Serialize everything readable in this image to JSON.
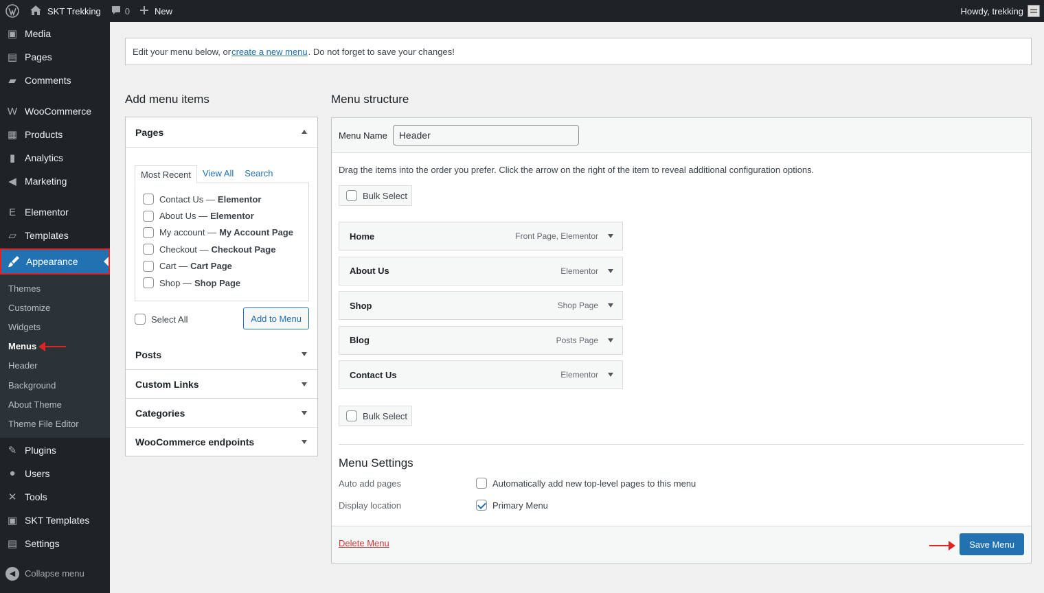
{
  "adminbar": {
    "site_name": "SKT Trekking",
    "comments_count": "0",
    "new_label": "New",
    "howdy": "Howdy, trekking"
  },
  "sidebar": {
    "items_top": [
      {
        "label": "Media",
        "icon": "media-icon"
      },
      {
        "label": "Pages",
        "icon": "pages-icon"
      },
      {
        "label": "Comments",
        "icon": "comments-icon"
      }
    ],
    "items_woo": [
      {
        "label": "WooCommerce",
        "icon": "woocommerce-icon"
      },
      {
        "label": "Products",
        "icon": "products-icon"
      },
      {
        "label": "Analytics",
        "icon": "analytics-icon"
      },
      {
        "label": "Marketing",
        "icon": "marketing-icon"
      }
    ],
    "items_elementor": [
      {
        "label": "Elementor",
        "icon": "elementor-icon"
      },
      {
        "label": "Templates",
        "icon": "templates-icon"
      }
    ],
    "appearance_label": "Appearance",
    "submenu": [
      "Themes",
      "Customize",
      "Widgets",
      "Menus",
      "Header",
      "Background",
      "About Theme",
      "Theme File Editor"
    ],
    "items_bottom": [
      {
        "label": "Plugins",
        "icon": "plugins-icon"
      },
      {
        "label": "Users",
        "icon": "users-icon"
      },
      {
        "label": "Tools",
        "icon": "tools-icon"
      },
      {
        "label": "SKT Templates",
        "icon": "skt-templates-icon"
      },
      {
        "label": "Settings",
        "icon": "settings-icon"
      }
    ],
    "collapse_label": "Collapse menu"
  },
  "notice": {
    "before": "Edit your menu below, or ",
    "link": "create a new menu",
    "after": ". Do not forget to save your changes!"
  },
  "add_items": {
    "title": "Add menu items",
    "pages_label": "Pages",
    "tabs": [
      "Most Recent",
      "View All",
      "Search"
    ],
    "page_options": [
      {
        "name": "Contact Us —",
        "template": "Elementor"
      },
      {
        "name": "About Us —",
        "template": "Elementor"
      },
      {
        "name": "My account —",
        "template": "My Account Page"
      },
      {
        "name": "Checkout —",
        "template": "Checkout Page"
      },
      {
        "name": "Cart —",
        "template": "Cart Page"
      },
      {
        "name": "Shop —",
        "template": "Shop Page"
      }
    ],
    "select_all": "Select All",
    "add_to_menu": "Add to Menu",
    "other_sections": [
      "Posts",
      "Custom Links",
      "Categories",
      "WooCommerce endpoints"
    ]
  },
  "menu_structure": {
    "title": "Menu structure",
    "menu_name_label": "Menu Name",
    "menu_name_value": "Header",
    "instruction": "Drag the items into the order you prefer. Click the arrow on the right of the item to reveal additional configuration options.",
    "bulk_select": "Bulk Select",
    "items": [
      {
        "title": "Home",
        "type": "Front Page, Elementor"
      },
      {
        "title": "About Us",
        "type": "Elementor"
      },
      {
        "title": "Shop",
        "type": "Shop Page"
      },
      {
        "title": "Blog",
        "type": "Posts Page"
      },
      {
        "title": "Contact Us",
        "type": "Elementor"
      }
    ],
    "settings_title": "Menu Settings",
    "auto_add_label": "Auto add pages",
    "auto_add_text": "Automatically add new top-level pages to this menu",
    "auto_add_checked": false,
    "display_location_label": "Display location",
    "display_location_text": "Primary Menu",
    "display_location_checked": true,
    "delete_menu": "Delete Menu",
    "save_menu": "Save Menu"
  },
  "colors": {
    "admin_dark": "#1d2327",
    "accent_blue": "#2271b1",
    "highlight_red": "#e02424",
    "delete_red": "#d63638"
  }
}
